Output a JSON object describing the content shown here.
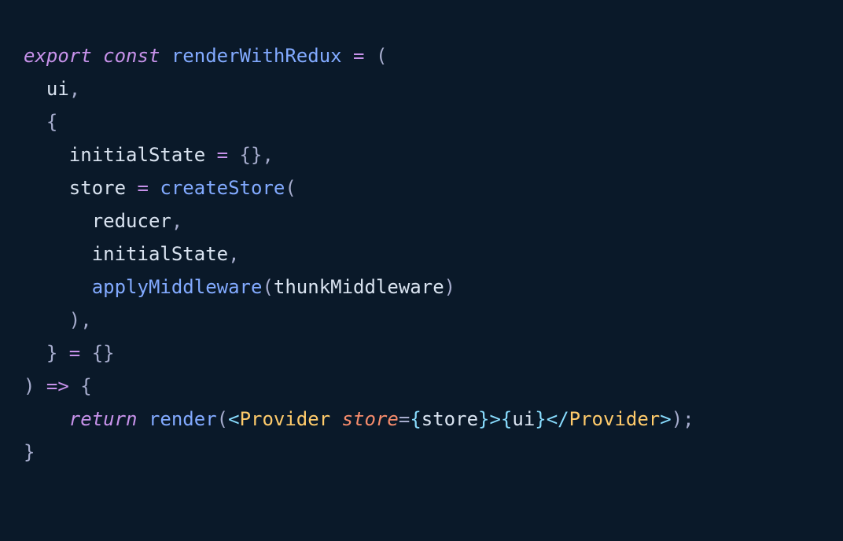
{
  "code": {
    "colors": {
      "background": "#0a1929",
      "keyword": "#c792ea",
      "function": "#82aaff",
      "punctuation": "#a6accd",
      "parameter": "#d9e3f0",
      "attribute": "#f78c6c",
      "tag": "#ffcb6b",
      "tagBracket": "#89ddff"
    },
    "tokens": {
      "kw_export": "export",
      "kw_const": "const",
      "fn_renderWithRedux": "renderWithRedux",
      "op_eq1": " = ",
      "p_openParen1": "(",
      "param_ui": "  ui",
      "p_comma1": ",",
      "p_openBrace1": "  {",
      "param_initialState1": "    initialState",
      "op_eq2": " = ",
      "p_emptyObj": "{}",
      "p_comma2": ",",
      "param_store1": "    store",
      "op_eq3": " = ",
      "fn_createStore": "createStore",
      "p_openParen2": "(",
      "param_reducer": "      reducer",
      "p_comma3": ",",
      "param_initialState2": "      initialState",
      "p_comma4": ",",
      "fn_applyMiddleware_indent": "      ",
      "fn_applyMiddleware": "applyMiddleware",
      "p_openParen3": "(",
      "param_thunkMiddleware": "thunkMiddleware",
      "p_closeParen3": ")",
      "p_closeParen2": "    )",
      "p_comma5": ",",
      "p_closeBrace1": "  }",
      "op_eq4": " = ",
      "p_emptyObj2": "{}",
      "p_closeParen1": ")",
      "op_arrow": " => ",
      "p_openBrace2": "{",
      "kw_return_indent": "    ",
      "kw_return": "return",
      "sp_afterReturn": " ",
      "fn_render": "render",
      "p_openParen4": "(",
      "jsx_open_lt": "<",
      "jsx_Provider_open": "Provider",
      "sp_beforeAttr": " ",
      "jsx_attr_store": "store",
      "jsx_attr_eq": "=",
      "jsx_expr_open": "{",
      "jsx_expr_store": "store",
      "jsx_expr_close": "}",
      "jsx_open_gt": ">",
      "jsx_ui_open": "{",
      "jsx_ui": "ui",
      "jsx_ui_close": "}",
      "jsx_close_lt": "</",
      "jsx_Provider_close": "Provider",
      "jsx_close_gt": ">",
      "p_closeParen4": ")",
      "p_semi": ";",
      "p_closeBrace2": "}"
    }
  }
}
